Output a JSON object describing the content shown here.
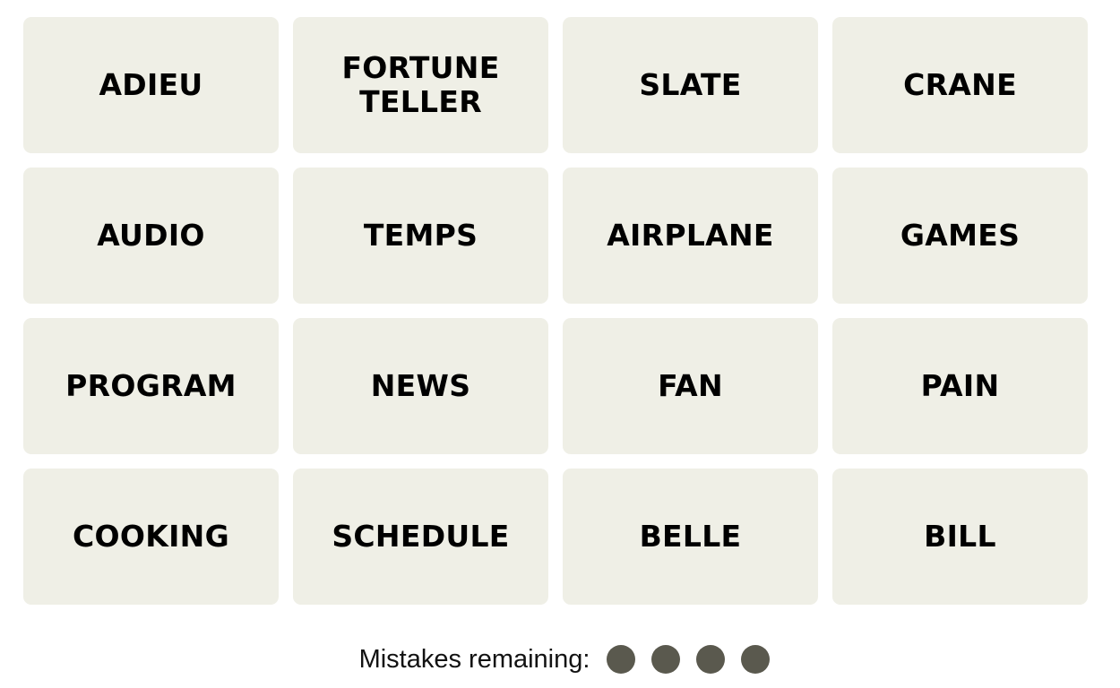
{
  "board": {
    "tiles": [
      {
        "label": "ADIEU"
      },
      {
        "label": "FORTUNE\nTELLER"
      },
      {
        "label": "SLATE"
      },
      {
        "label": "CRANE"
      },
      {
        "label": "AUDIO"
      },
      {
        "label": "TEMPS"
      },
      {
        "label": "AIRPLANE"
      },
      {
        "label": "GAMES"
      },
      {
        "label": "PROGRAM"
      },
      {
        "label": "NEWS"
      },
      {
        "label": "FAN"
      },
      {
        "label": "PAIN"
      },
      {
        "label": "COOKING"
      },
      {
        "label": "SCHEDULE"
      },
      {
        "label": "BELLE"
      },
      {
        "label": "BILL"
      }
    ]
  },
  "status": {
    "mistakes_label": "Mistakes remaining:",
    "mistakes_remaining": 4,
    "dot_color": "#5a594e"
  },
  "colors": {
    "tile_bg": "#efefe6",
    "tile_text": "#000000"
  }
}
